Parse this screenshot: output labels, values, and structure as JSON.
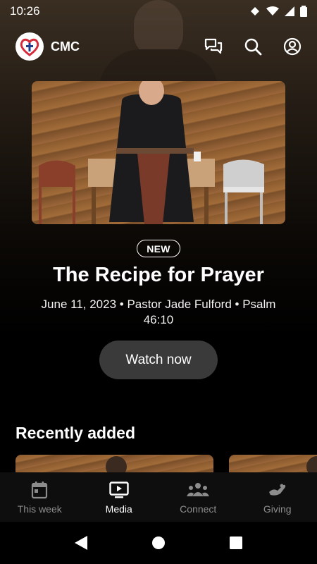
{
  "status_bar": {
    "time": "10:26"
  },
  "app_bar": {
    "title": "CMC"
  },
  "hero": {
    "badge": "NEW",
    "title": "The Recipe for Prayer",
    "meta": "June 11, 2023 • Pastor Jade Fulford • Psalm 46:10",
    "cta_label": "Watch now"
  },
  "recent": {
    "title": "Recently added"
  },
  "bottom_nav": {
    "items": [
      {
        "label": "This week",
        "icon": "calendar-icon",
        "active": false
      },
      {
        "label": "Media",
        "icon": "tv-play-icon",
        "active": true
      },
      {
        "label": "Connect",
        "icon": "group-icon",
        "active": false
      },
      {
        "label": "Giving",
        "icon": "giving-hand-icon",
        "active": false
      }
    ]
  },
  "colors": {
    "accent_logo_red": "#d62b3a",
    "logo_blue": "#1f3d8a",
    "cta_background": "#3a3a3a",
    "nav_inactive": "#8c8c8c"
  }
}
